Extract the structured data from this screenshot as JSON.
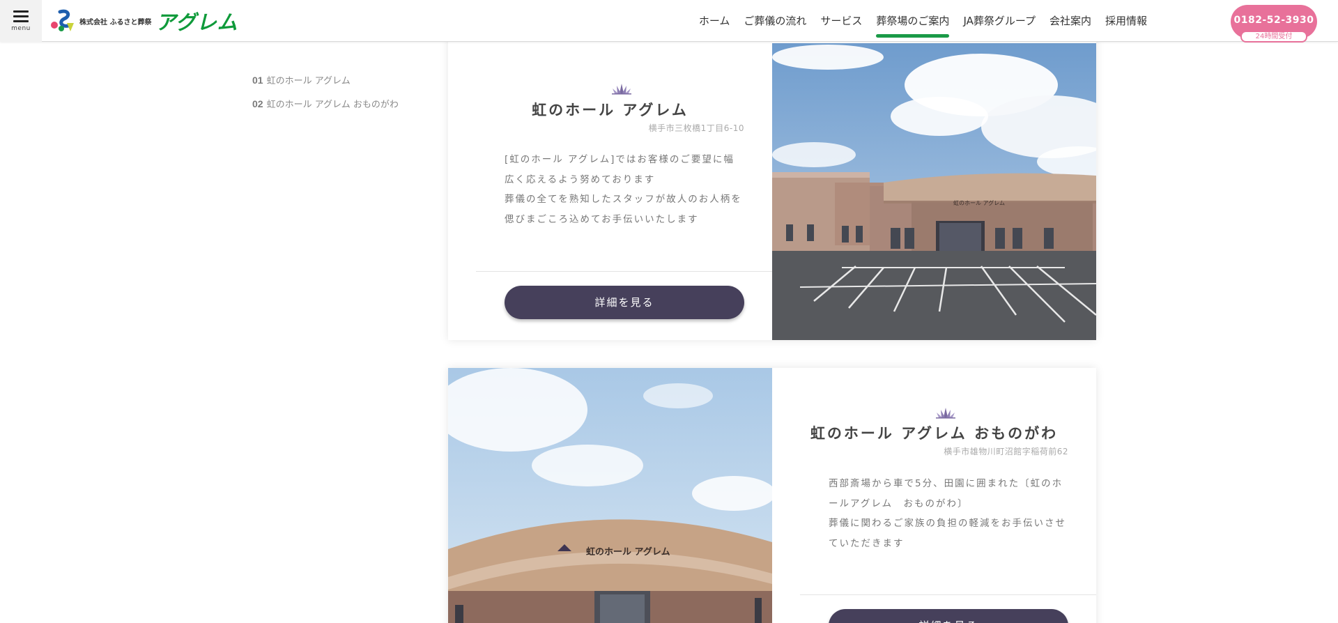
{
  "header": {
    "menu_label": "menu",
    "logo_company": "株式会社 ふるさと葬祭",
    "logo_brand": "アグレム",
    "nav": [
      {
        "label": "ホーム"
      },
      {
        "label": "ご葬儀の流れ"
      },
      {
        "label": "サービス"
      },
      {
        "label": "葬祭場のご案内",
        "active": true
      },
      {
        "label": "JA葬祭グループ"
      },
      {
        "label": "会社案内"
      },
      {
        "label": "採用情報"
      }
    ],
    "tel": {
      "number": "0182-52-3930",
      "sub": "24時間受付"
    }
  },
  "sidebar": {
    "items": [
      {
        "num": "01",
        "label": "虹のホール アグレム"
      },
      {
        "num": "02",
        "label": "虹のホール アグレム おものがわ"
      }
    ]
  },
  "halls": [
    {
      "title": "虹のホール アグレム",
      "address": "横手市三枚橋1丁目6-10",
      "desc_lines": [
        "[虹のホール アグレム]ではお客様のご要望に幅",
        "広く応えるよう努めております",
        "葬儀の全てを熟知したスタッフが故人のお人柄を",
        "偲びまごころ込めてお手伝いいたします"
      ],
      "button": "詳細を見る",
      "sign": "虹のホール アグレム"
    },
    {
      "title": "虹のホール アグレム おものがわ",
      "address": "横手市雄物川町沼館字稲荷前62",
      "desc_lines": [
        "西部斎場から車で5分、田園に囲まれた〔虹のホ",
        "ールアグレム　おものがわ〕",
        "葬儀に関わるご家族の負担の軽減をお手伝いさせ",
        "ていただきます"
      ],
      "button": "詳細を見る",
      "sign": "虹のホール アグレム"
    }
  ],
  "colors": {
    "brand_green": "#0f9a3a",
    "nav_active": "#1a9a47",
    "tel_pink": "#e8719a",
    "button_dark": "#46405b"
  }
}
